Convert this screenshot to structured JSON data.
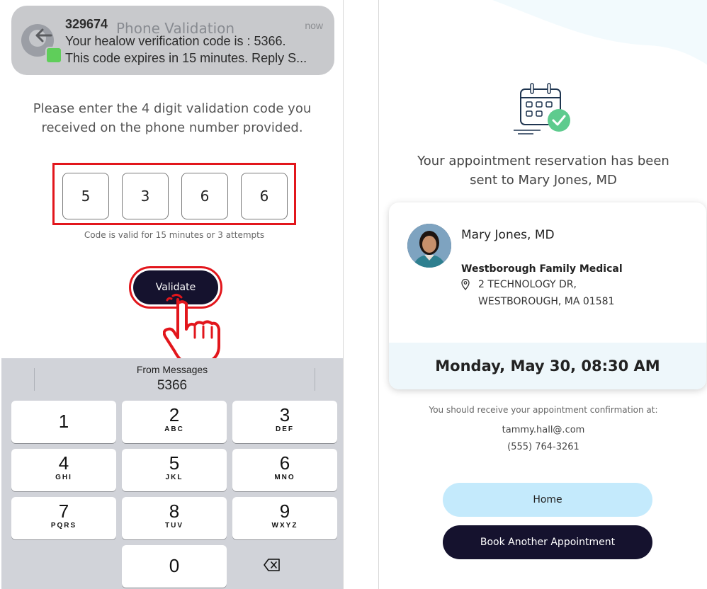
{
  "colors": {
    "navy": "#15122e",
    "highlight_red": "#e2161c",
    "light_blue_button": "#c4eafc",
    "date_band": "#eef7fb",
    "keyboard_bg": "#d1d3d9",
    "notification_bg": "#c8c9cc",
    "calendar_check_green": "#5ecb8e"
  },
  "left_screen": {
    "notification": {
      "sender": "329674",
      "behind_title": "Phone Validation",
      "time": "now",
      "line1": "Your healow verification code is : 5366.",
      "line2": "This code expires in 15 minutes. Reply S...",
      "icons": [
        "back-arrow-icon",
        "contact-avatar-icon",
        "messages-app-icon"
      ]
    },
    "instruction": "Please enter the 4 digit validation code you received on the phone number provided.",
    "code_digits": [
      "5",
      "3",
      "6",
      "6"
    ],
    "code_hint": "Code is valid for 15 minutes or 3 attempts",
    "validate_button": "Validate",
    "pointer_icon": "tapping-hand-icon",
    "keyboard": {
      "suggestion_label": "From Messages",
      "suggestion_value": "5366",
      "keys": [
        {
          "number": "1",
          "letters": ""
        },
        {
          "number": "2",
          "letters": "ABC"
        },
        {
          "number": "3",
          "letters": "DEF"
        },
        {
          "number": "4",
          "letters": "GHI"
        },
        {
          "number": "5",
          "letters": "JKL"
        },
        {
          "number": "6",
          "letters": "MNO"
        },
        {
          "number": "7",
          "letters": "PQRS"
        },
        {
          "number": "8",
          "letters": "TUV"
        },
        {
          "number": "9",
          "letters": "WXYZ"
        },
        {
          "number": "0",
          "letters": ""
        }
      ],
      "delete_icon": "backspace-icon"
    }
  },
  "right_screen": {
    "icon": "calendar-check-icon",
    "confirmation_title": "Your appointment reservation has been sent to Mary Jones, MD",
    "provider": {
      "name": "Mary Jones, MD",
      "practice": "Westborough Family Medical",
      "address_line1": "2 TECHNOLOGY DR,",
      "address_line2": "WESTBOROUGH, MA 01581",
      "location_icon": "map-pin-icon"
    },
    "appointment_datetime": "Monday, May 30, 08:30 AM",
    "confirmation_note": "You should receive your appointment confirmation at:",
    "email": "tammy.hall@.com",
    "phone": "(555) 764-3261",
    "home_button": "Home",
    "book_button": "Book Another Appointment"
  }
}
